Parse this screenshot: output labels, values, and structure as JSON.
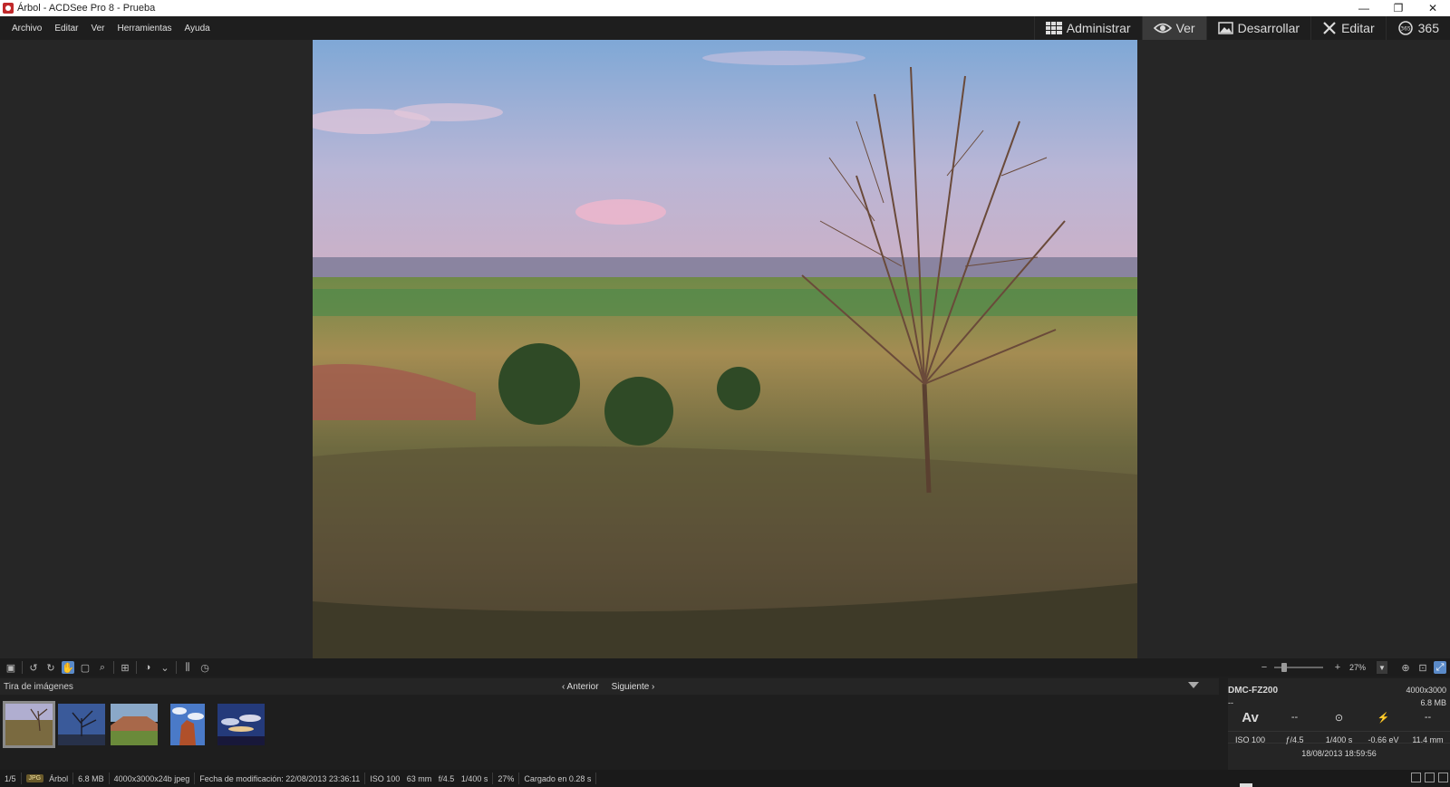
{
  "window": {
    "title": "Árbol - ACDSee Pro 8 - Prueba",
    "minimize": "—",
    "restore": "❐",
    "close": "✕"
  },
  "menu": [
    "Archivo",
    "Editar",
    "Ver",
    "Herramientas",
    "Ayuda"
  ],
  "modes": [
    {
      "label": "Administrar",
      "icon": "grid-icon"
    },
    {
      "label": "Ver",
      "icon": "eye-icon",
      "active": true
    },
    {
      "label": "Desarrollar",
      "icon": "image-icon"
    },
    {
      "label": "Editar",
      "icon": "tools-icon"
    },
    {
      "label": "365",
      "icon": "cloud-365-icon"
    }
  ],
  "toolbar": {
    "zoom_minus": "−",
    "zoom_plus": "+",
    "zoom_value": "27%",
    "zoom_fraction": 0.27
  },
  "strip": {
    "title": "Tira de imágenes",
    "prev": "‹ Anterior",
    "next": "Siguiente ›",
    "thumbs": [
      "Árbol",
      "tree-night",
      "mesa",
      "rock",
      "clouds"
    ]
  },
  "info": {
    "camera": "DMC-FZ200",
    "dimensions": "4000x3000",
    "dash": "--",
    "filesize": "6.8 MB",
    "mode": "Av",
    "metering_dash": "--",
    "last_dash": "--",
    "iso": "ISO 100",
    "aperture": "ƒ/4.5",
    "shutter": "1/400 s",
    "ev": "-0.66 eV",
    "focal": "11.4 mm",
    "date": "18/08/2013 18:59:56"
  },
  "status": {
    "index": "1/5",
    "format": "JPG",
    "name": "Árbol",
    "size": "6.8 MB",
    "info": "4000x3000x24b jpeg",
    "modified": "Fecha de modificación: 22/08/2013 23:36:11",
    "iso": "ISO 100",
    "focal": "63 mm",
    "aperture": "f/4.5",
    "shutter": "1/400 s",
    "zoom": "27%",
    "loaded": "Cargado en 0.28 s"
  }
}
